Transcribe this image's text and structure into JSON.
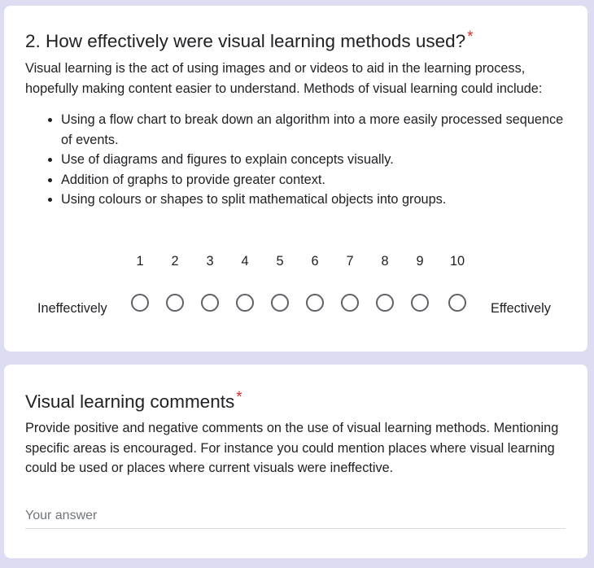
{
  "question2": {
    "title": "2. How effectively were visual learning methods used?",
    "required_marker": "*",
    "intro": "Visual learning is the act of using images and or videos to aid in the learning process, hopefully making content easier to understand. Methods of visual learning could include:",
    "bullets": [
      "Using a flow chart to break down an algorithm into a more easily processed sequence of events.",
      "Use of diagrams and figures to explain concepts visually.",
      "Addition of graphs to provide greater context.",
      "Using colours or shapes to split mathematical objects into groups."
    ],
    "scale": {
      "low_label": "Ineffectively",
      "high_label": "Effectively",
      "numbers": [
        "1",
        "2",
        "3",
        "4",
        "5",
        "6",
        "7",
        "8",
        "9",
        "10"
      ],
      "selected": null
    }
  },
  "comments": {
    "title": "Visual learning comments",
    "required_marker": "*",
    "description": "Provide positive and negative comments on the use of visual learning methods. Mentioning specific areas is encouraged. For instance you could mention places where visual learning could be used or places where current visuals were ineffective.",
    "answer_value": "",
    "answer_placeholder": "Your answer"
  },
  "colors": {
    "page_background": "#dcdcf2",
    "card_background": "#ffffff",
    "required_asterisk": "#d93025",
    "radio_border": "#5f6368"
  }
}
